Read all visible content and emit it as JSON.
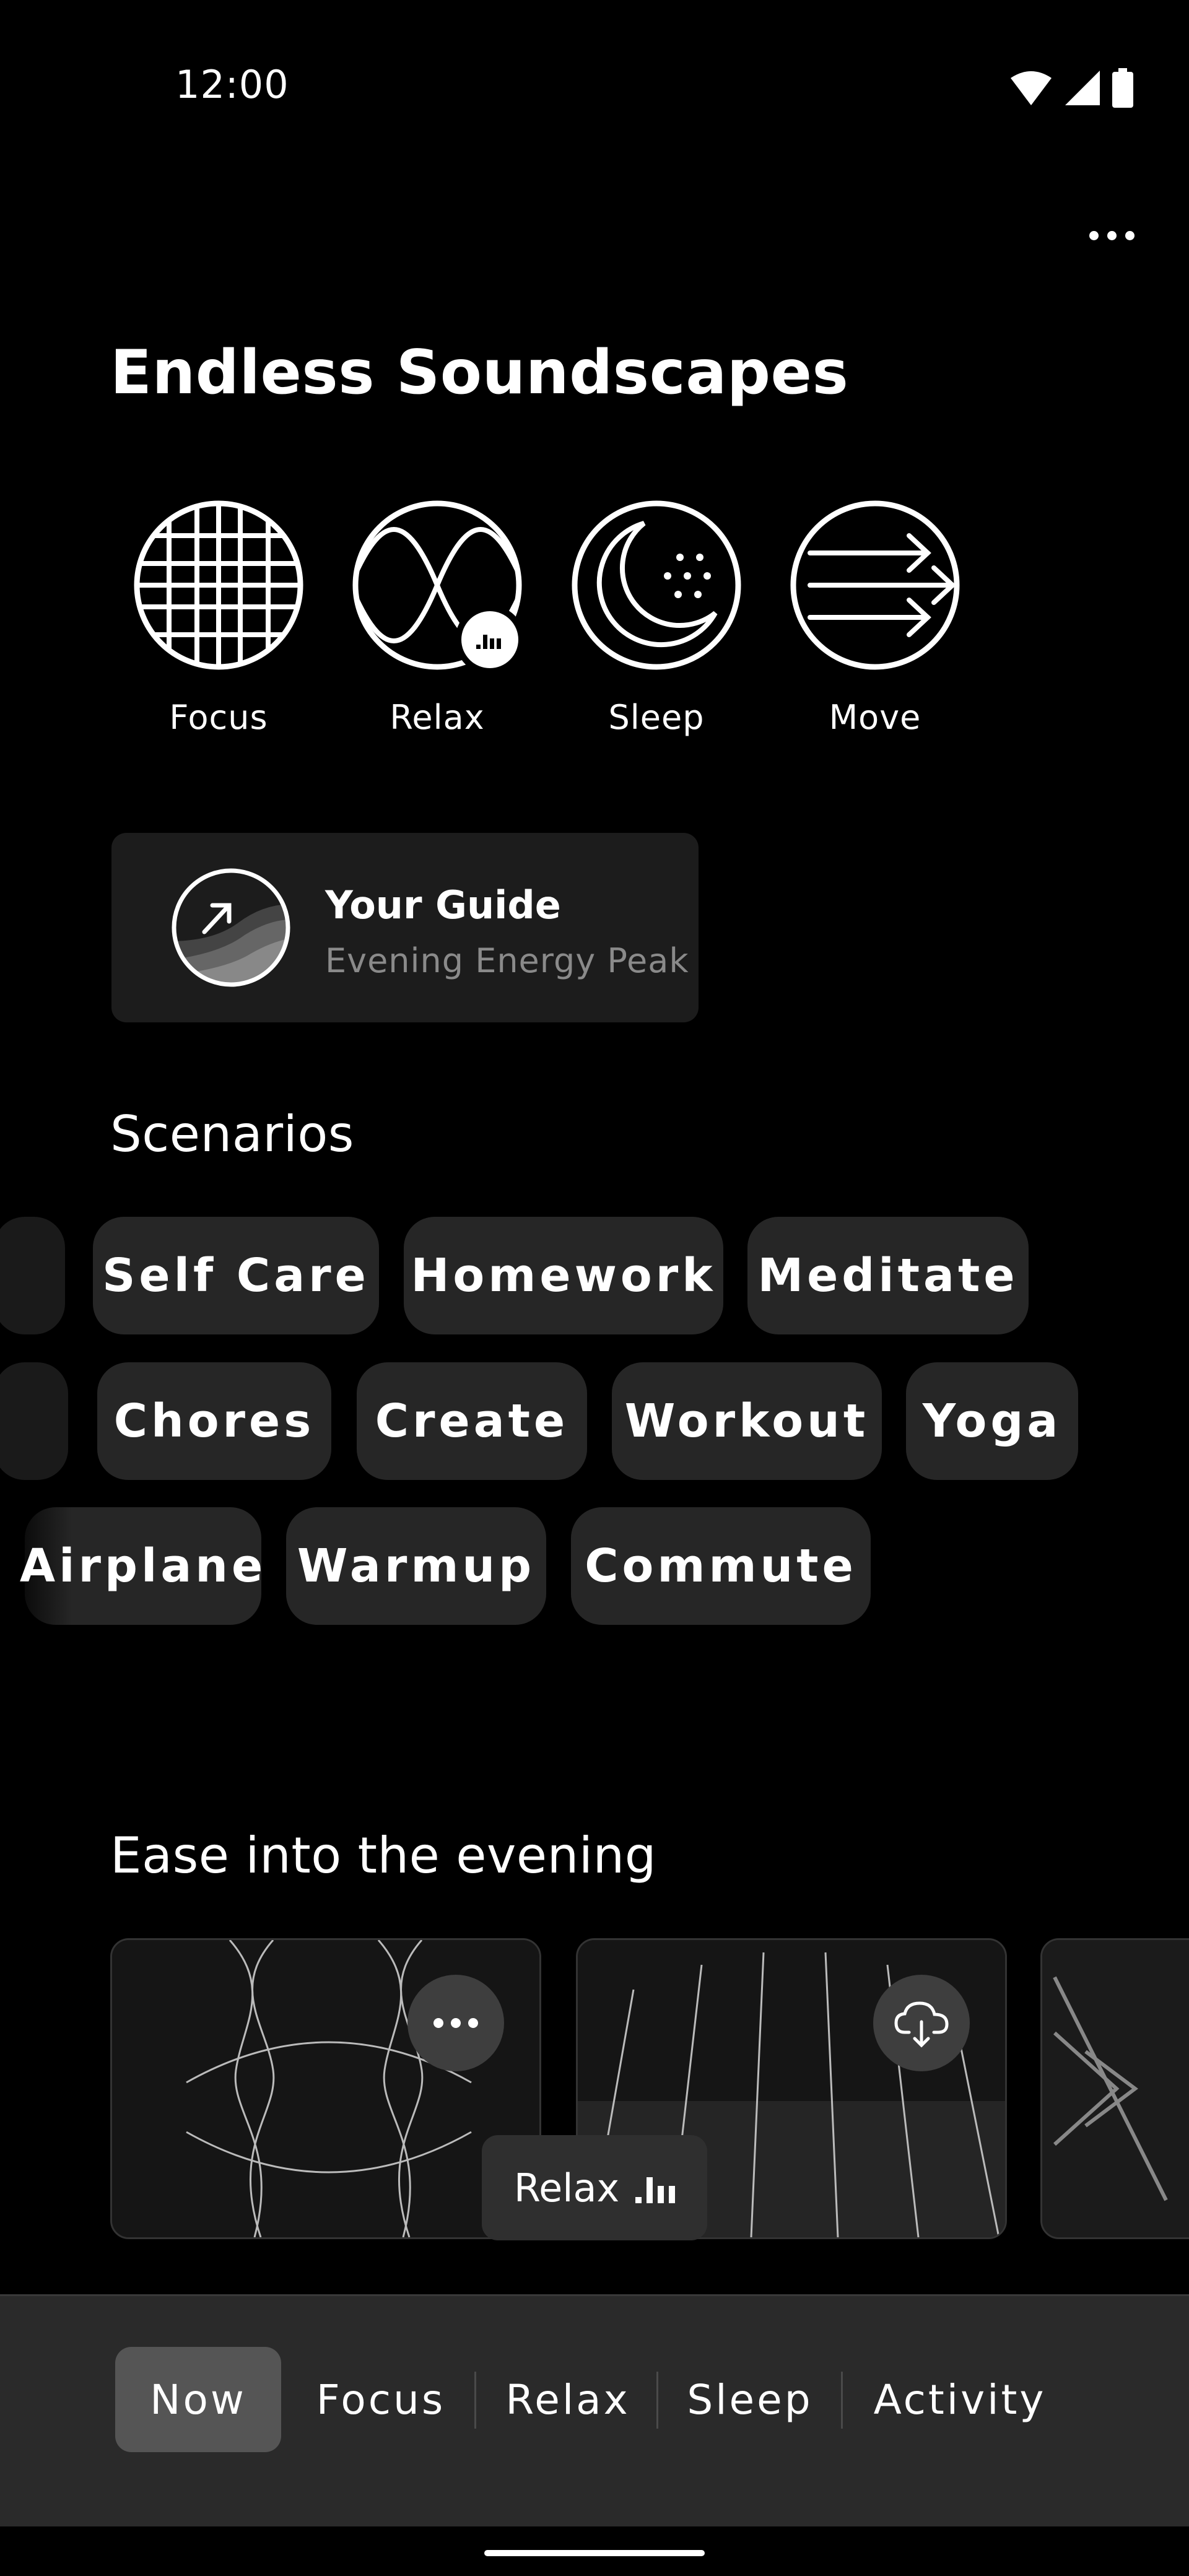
{
  "status_bar": {
    "time": "12:00"
  },
  "header": {
    "title": "Endless Soundscapes"
  },
  "modes": [
    {
      "label": "Focus",
      "icon": "grid-sphere-icon"
    },
    {
      "label": "Relax",
      "icon": "wave-circle-icon"
    },
    {
      "label": "Sleep",
      "icon": "moon-icon"
    },
    {
      "label": "Move",
      "icon": "arrows-icon"
    }
  ],
  "guide": {
    "title": "Your Guide",
    "subtitle": "Evening Energy Peak"
  },
  "scenarios": {
    "title": "Scenarios",
    "row1": [
      "Self Care",
      "Homework",
      "Meditate"
    ],
    "row2": [
      "Chores",
      "Create",
      "Workout",
      "Yoga"
    ],
    "row3": [
      "Airplane",
      "Warmup",
      "Commute"
    ]
  },
  "evening": {
    "title": "Ease into the evening"
  },
  "now_playing": {
    "label": "Relax"
  },
  "bottom_nav": {
    "items": [
      "Now",
      "Focus",
      "Relax",
      "Sleep",
      "Activity"
    ],
    "active": "Now"
  }
}
